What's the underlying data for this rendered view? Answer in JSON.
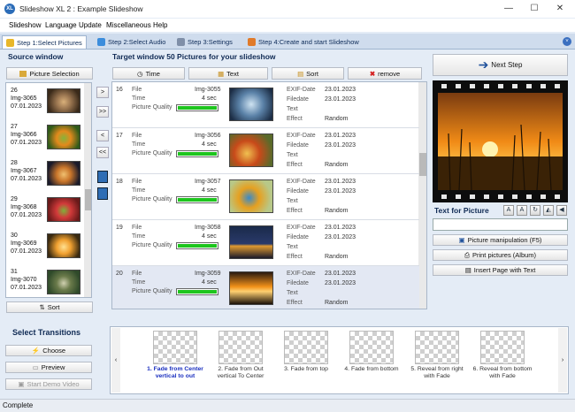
{
  "window": {
    "title": "Slideshow XL 2 : Example Slideshow",
    "app_icon": "XL"
  },
  "menu": [
    "Slideshow",
    "Language",
    "Update",
    "Miscellaneous",
    "Help"
  ],
  "tabs": [
    {
      "label": "Step 1:Select Pictures",
      "active": true
    },
    {
      "label": "Step 2:Select Audio",
      "active": false
    },
    {
      "label": "Step 3:Settings",
      "active": false
    },
    {
      "label": "Step 4:Create and start Slideshow",
      "active": false
    }
  ],
  "source": {
    "title": "Source window",
    "picture_selection_label": "Picture Selection",
    "sort_label": "Sort",
    "items": [
      {
        "num": "26",
        "name": "Img-3065",
        "date": "07.01.2023"
      },
      {
        "num": "27",
        "name": "Img-3066",
        "date": "07.01.2023"
      },
      {
        "num": "28",
        "name": "Img-3067",
        "date": "07.01.2023"
      },
      {
        "num": "29",
        "name": "Img-3068",
        "date": "07.01.2023"
      },
      {
        "num": "30",
        "name": "Img-3069",
        "date": "07.01.2023"
      },
      {
        "num": "31",
        "name": "Img-3070",
        "date": "07.01.2023"
      }
    ]
  },
  "transfer_buttons": [
    ">",
    ">>",
    "<",
    "<<"
  ],
  "target": {
    "title": "Target window 50 Pictures for your slideshow",
    "toolbar": {
      "time": "Time",
      "text": "Text",
      "sort": "Sort",
      "remove": "remove"
    },
    "field_labels": {
      "file": "File",
      "time": "Time",
      "quality": "Picture Quality",
      "exif": "EXIF-Date",
      "filedate": "Filedate",
      "text": "Text",
      "effect": "Effect"
    },
    "rows": [
      {
        "num": "16",
        "file": "Img-3055",
        "time": "4 sec",
        "quality": 1.0,
        "exif": "23.01.2023",
        "filedate": "23.01.2023",
        "effect": "Random"
      },
      {
        "num": "17",
        "file": "Img-3056",
        "time": "4 sec",
        "quality": 1.0,
        "exif": "23.01.2023",
        "filedate": "23.01.2023",
        "effect": "Random"
      },
      {
        "num": "18",
        "file": "Img-3057",
        "time": "4 sec",
        "quality": 1.0,
        "exif": "23.01.2023",
        "filedate": "23.01.2023",
        "effect": "Random"
      },
      {
        "num": "19",
        "file": "Img-3058",
        "time": "4 sec",
        "quality": 1.0,
        "exif": "23.01.2023",
        "filedate": "23.01.2023",
        "effect": "Random"
      },
      {
        "num": "20",
        "file": "Img-3059",
        "time": "4 sec",
        "quality": 1.0,
        "exif": "23.01.2023",
        "filedate": "23.01.2023",
        "effect": "Random"
      }
    ]
  },
  "right_panel": {
    "next_step": "Next Step",
    "text_for_picture": "Text for Picture",
    "picture_manipulation": "Picture manipulation (F5)",
    "print_pictures": "Print pictures (Album)",
    "insert_page": "Insert Page with Text"
  },
  "transitions": {
    "title": "Select Transitions",
    "choose": "Choose",
    "preview": "Preview",
    "start_demo": "Start Demo Video",
    "items": [
      {
        "label": "1. Fade from Center vertical to out",
        "selected": true
      },
      {
        "label": "2. Fade from Out vertical To Center",
        "selected": false
      },
      {
        "label": "3. Fade from top",
        "selected": false
      },
      {
        "label": "4. Fade from bottom",
        "selected": false
      },
      {
        "label": "5. Reveal from right with Fade",
        "selected": false
      },
      {
        "label": "6. Reveal from bottom with Fade",
        "selected": false
      }
    ]
  },
  "status": "Complete"
}
